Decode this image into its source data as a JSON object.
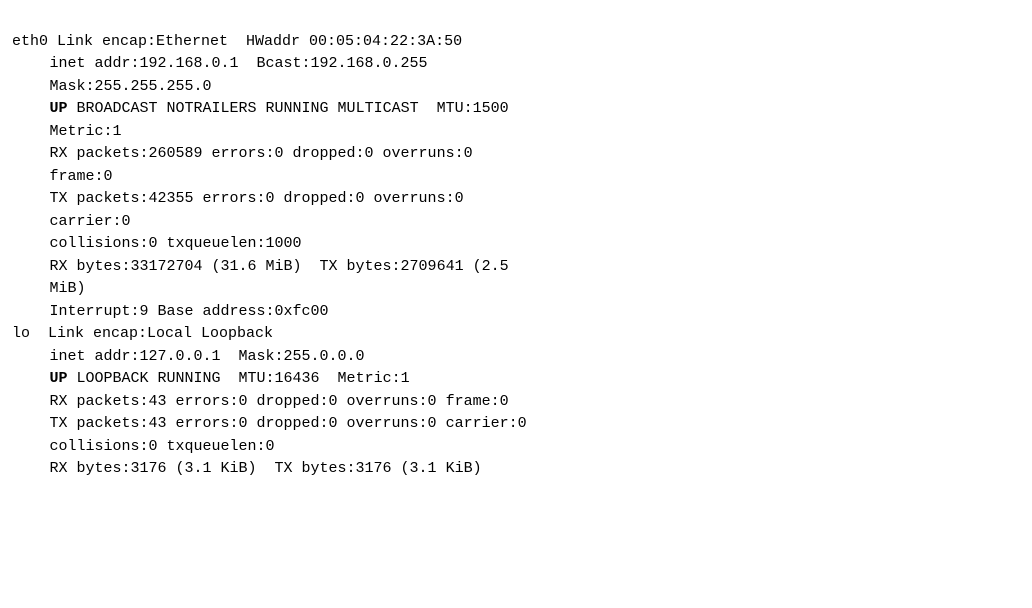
{
  "terminal": {
    "lines": [
      {
        "id": "eth0-header",
        "indent": false,
        "parts": [
          {
            "text": "eth0 Link encap:Ethernet  HWaddr 00:05:04:22:3A:50",
            "bold": false
          }
        ]
      },
      {
        "id": "eth0-inet",
        "indent": true,
        "parts": [
          {
            "text": "inet addr:192.168.0.1  Bcast:192.168.0.255",
            "bold": false
          }
        ]
      },
      {
        "id": "eth0-mask",
        "indent": true,
        "parts": [
          {
            "text": "Mask:255.255.255.0",
            "bold": false
          }
        ]
      },
      {
        "id": "eth0-up",
        "indent": true,
        "parts": [
          {
            "text": "UP",
            "bold": true
          },
          {
            "text": " BROADCAST NOTRAILERS RUNNING MULTICAST  MTU:1500",
            "bold": false
          }
        ]
      },
      {
        "id": "eth0-metric",
        "indent": true,
        "parts": [
          {
            "text": "Metric:1",
            "bold": false
          }
        ]
      },
      {
        "id": "eth0-rx",
        "indent": true,
        "parts": [
          {
            "text": "RX packets:260589 errors:0 dropped:0 overruns:0",
            "bold": false
          }
        ]
      },
      {
        "id": "eth0-frame",
        "indent": true,
        "parts": [
          {
            "text": "frame:0",
            "bold": false
          }
        ]
      },
      {
        "id": "eth0-tx",
        "indent": true,
        "parts": [
          {
            "text": "TX packets:42355 errors:0 dropped:0 overruns:0",
            "bold": false
          }
        ]
      },
      {
        "id": "eth0-carrier",
        "indent": true,
        "parts": [
          {
            "text": "carrier:0",
            "bold": false
          }
        ]
      },
      {
        "id": "eth0-collisions",
        "indent": true,
        "parts": [
          {
            "text": "collisions:0 txqueuelen:1000",
            "bold": false
          }
        ]
      },
      {
        "id": "eth0-rxbytes",
        "indent": true,
        "parts": [
          {
            "text": "RX bytes:33172704 (31.6 MiB)  TX bytes:2709641 (2.5",
            "bold": false
          }
        ]
      },
      {
        "id": "eth0-mib",
        "indent": true,
        "parts": [
          {
            "text": "MiB)",
            "bold": false
          }
        ]
      },
      {
        "id": "eth0-interrupt",
        "indent": true,
        "parts": [
          {
            "text": "Interrupt:9 Base address:0xfc00",
            "bold": false
          }
        ]
      },
      {
        "id": "lo-header",
        "indent": false,
        "parts": [
          {
            "text": "lo  Link encap:Local Loopback",
            "bold": false
          }
        ]
      },
      {
        "id": "lo-inet",
        "indent": true,
        "parts": [
          {
            "text": "inet addr:127.0.0.1  Mask:255.0.0.0",
            "bold": false
          }
        ]
      },
      {
        "id": "lo-up",
        "indent": true,
        "parts": [
          {
            "text": "UP",
            "bold": true
          },
          {
            "text": " LOOPBACK RUNNING  MTU:16436  Metric:1",
            "bold": false
          }
        ]
      },
      {
        "id": "lo-rx",
        "indent": true,
        "parts": [
          {
            "text": "RX packets:43 errors:0 dropped:0 overruns:0 frame:0",
            "bold": false
          }
        ]
      },
      {
        "id": "lo-tx",
        "indent": true,
        "parts": [
          {
            "text": "TX packets:43 errors:0 dropped:0 overruns:0 carrier:0",
            "bold": false
          }
        ]
      },
      {
        "id": "lo-collisions",
        "indent": true,
        "parts": [
          {
            "text": "collisions:0 txqueuelen:0",
            "bold": false
          }
        ]
      },
      {
        "id": "lo-rxbytes",
        "indent": true,
        "parts": [
          {
            "text": "RX bytes:3176 (3.1 KiB)  TX bytes:3176 (3.1 KiB)",
            "bold": false
          }
        ]
      }
    ]
  }
}
